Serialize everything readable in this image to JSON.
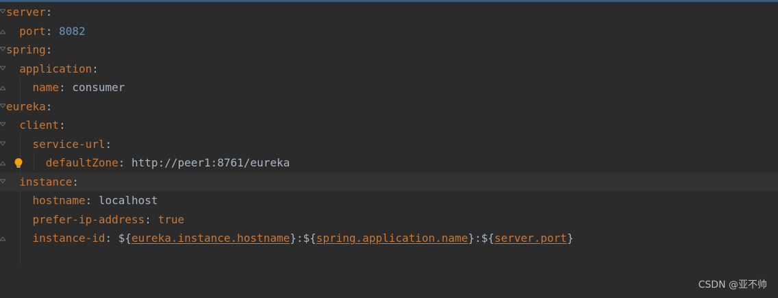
{
  "editor": {
    "lines": [
      {
        "key": "server",
        "sep": ":",
        "value": ""
      },
      {
        "key": "port",
        "sep": ": ",
        "value": "8082"
      },
      {
        "key": "spring",
        "sep": ":",
        "value": ""
      },
      {
        "key": "application",
        "sep": ":",
        "value": ""
      },
      {
        "key": "name",
        "sep": ": ",
        "value": "consumer"
      },
      {
        "key": "eureka",
        "sep": ":",
        "value": ""
      },
      {
        "key": "client",
        "sep": ":",
        "value": ""
      },
      {
        "key": "service-url",
        "sep": ":",
        "value": ""
      },
      {
        "key": "defaultZone",
        "sep": ": ",
        "value": "http://peer1:8761/eureka"
      },
      {
        "key": "instance",
        "sep": ":",
        "value": ""
      },
      {
        "key": "hostname",
        "sep": ": ",
        "value": "localhost"
      },
      {
        "key": "prefer-ip-address",
        "sep": ": ",
        "value": "true"
      },
      {
        "key": "instance-id",
        "sep": ": ",
        "value_parts": {
          "p1": "${",
          "r1": "eureka.instance.hostname",
          "p2": "}:${",
          "r2": "spring.application.name",
          "p3": "}:${",
          "r3": "server.port",
          "p4": "}"
        }
      }
    ]
  },
  "watermark": "CSDN @亚不帅",
  "colors": {
    "background": "#2b2b2b",
    "key": "#cc7832",
    "text": "#a9b7c6",
    "number": "#6897bb",
    "current_line": "#323232"
  },
  "icons": {
    "bulb": "lightbulb-icon",
    "fold": "fold-arrow-icon"
  }
}
